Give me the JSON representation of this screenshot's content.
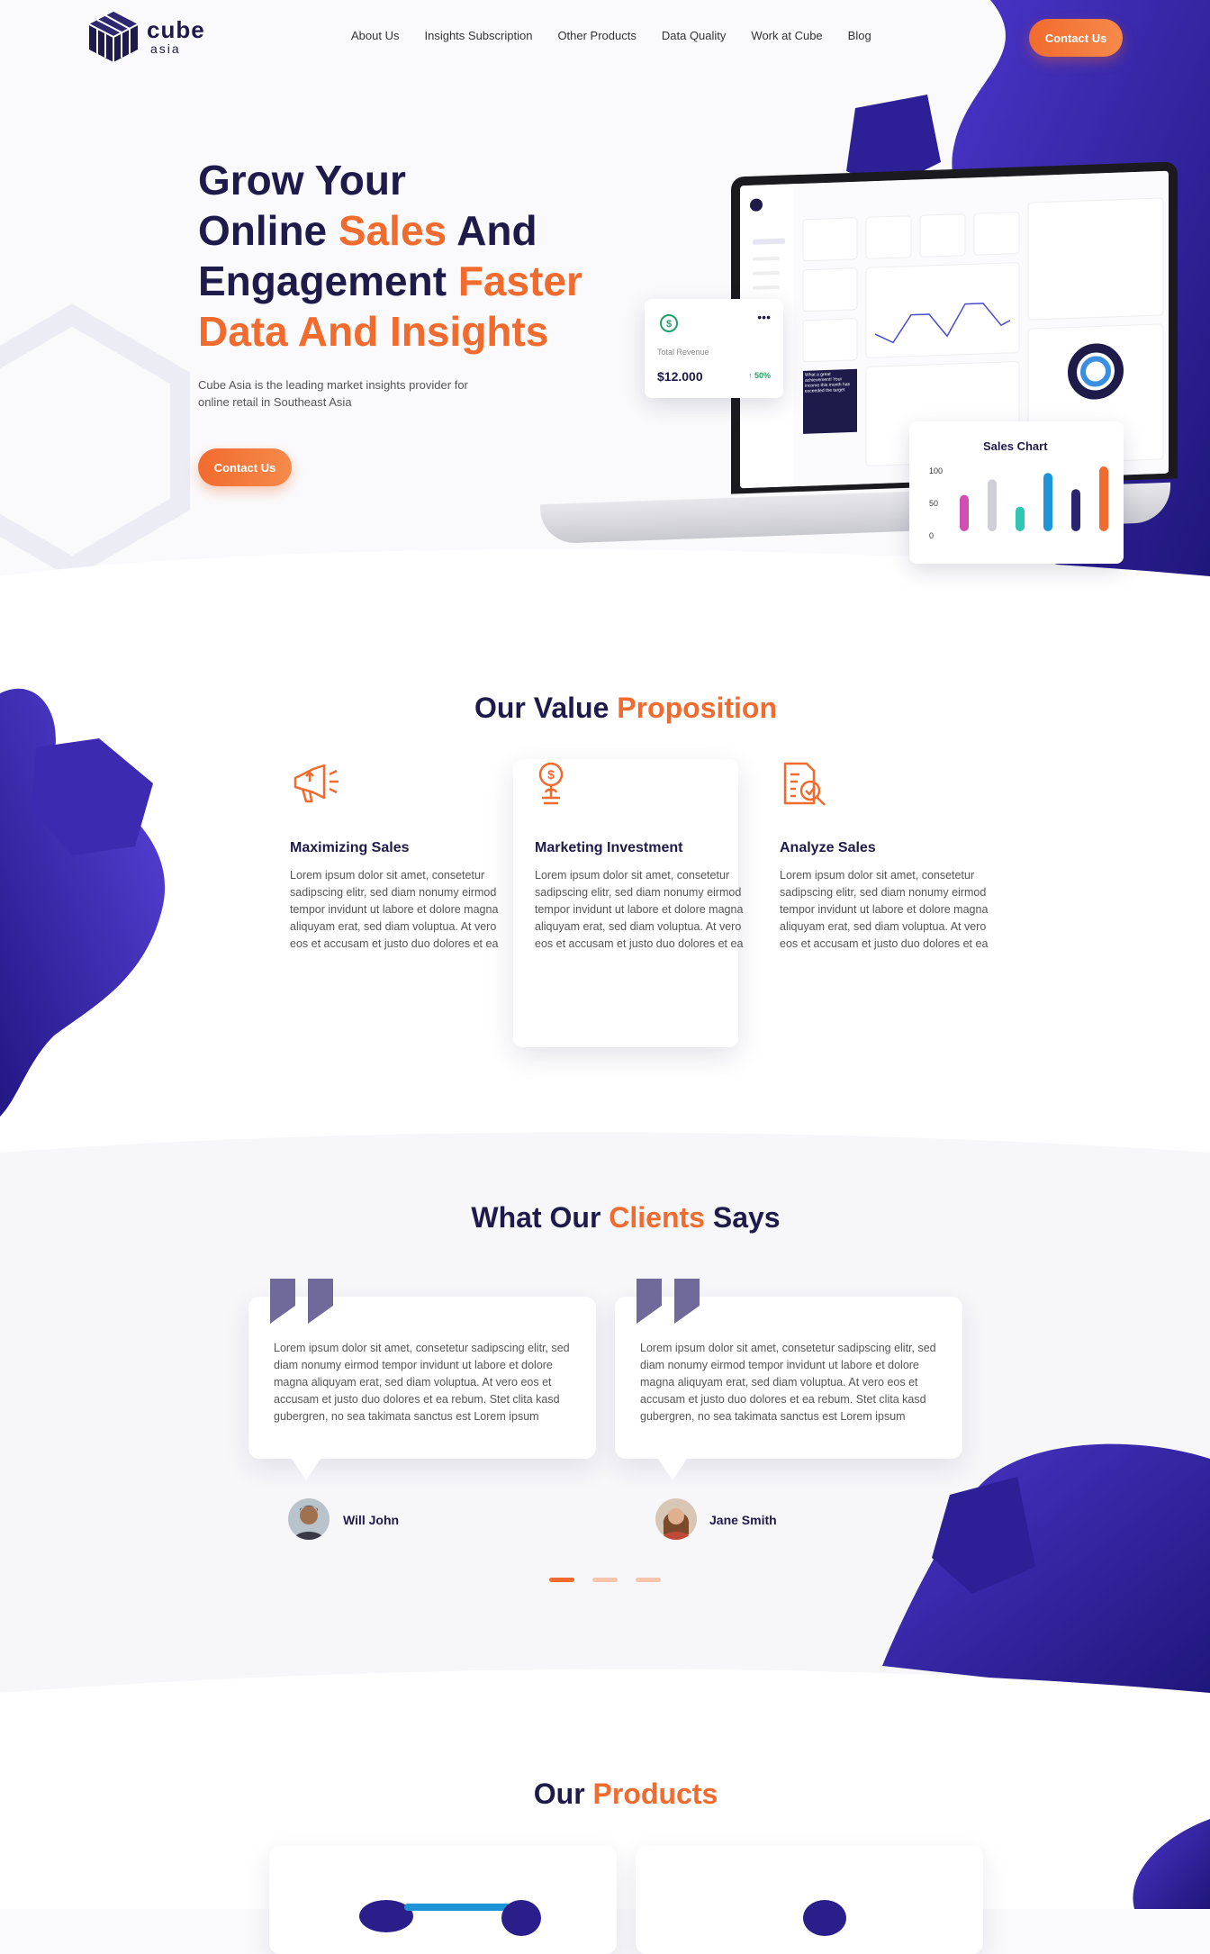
{
  "brand": {
    "name": "cube",
    "sub": "asia"
  },
  "nav": {
    "items": [
      "About Us",
      "Insights Subscription",
      "Other Products",
      "Data Quality",
      "Work at Cube",
      "Blog"
    ],
    "contact": "Contact Us"
  },
  "hero": {
    "line1": "Grow Your",
    "line2a": "Online ",
    "line2b": "Sales",
    "line2c": " And",
    "line3a": "Engagement ",
    "line3b": "Faster",
    "line4": "Data And Insights",
    "description": "Cube Asia is the leading market insights provider for online retail in Southeast Asia",
    "contact": "Contact Us",
    "revenue_card": {
      "label": "Total Revenue",
      "value": "$12.000",
      "change": "50%"
    },
    "sales_chart": {
      "title": "Sales Chart",
      "ticks": [
        "100",
        "50",
        "0"
      ],
      "values": [
        56,
        80,
        38,
        90,
        65,
        100
      ],
      "colors": [
        "#d14fb3",
        "#cfcfd6",
        "#2fc6b4",
        "#1e94d8",
        "#2a2470",
        "#f26b2e"
      ]
    },
    "dashboard_promo": "What a great achievement! Your income this month has exceeded the target"
  },
  "value": {
    "title_a": "Our Value ",
    "title_b": "Proposition",
    "features": [
      {
        "title": "Maximizing Sales",
        "icon": "megaphone-icon",
        "text": "Lorem ipsum dolor sit amet, consetetur sadipscing elitr, sed diam nonumy eirmod tempor invidunt ut labore et dolore magna aliquyam erat, sed diam voluptua. At vero eos et accusam et justo duo dolores et ea"
      },
      {
        "title": "Marketing Investment",
        "icon": "investment-icon",
        "text": "Lorem ipsum dolor sit amet, consetetur sadipscing elitr, sed diam nonumy eirmod tempor invidunt ut labore et dolore magna aliquyam erat, sed diam voluptua. At vero eos et accusam et justo duo dolores et ea"
      },
      {
        "title": "Analyze Sales",
        "icon": "analyze-icon",
        "text": "Lorem ipsum dolor sit amet, consetetur sadipscing elitr, sed diam nonumy eirmod tempor invidunt ut labore et dolore magna aliquyam erat, sed diam voluptua. At vero eos et accusam et justo duo dolores et ea"
      }
    ]
  },
  "clients": {
    "title_a": "What Our ",
    "title_b": "Clients",
    "title_c": " Says",
    "testimonials": [
      {
        "name": "Will John",
        "text": "Lorem ipsum dolor sit amet, consetetur sadipscing elitr, sed diam nonumy eirmod tempor invidunt ut labore et dolore magna aliquyam erat, sed diam voluptua. At vero eos et accusam et justo duo dolores et ea rebum. Stet clita kasd gubergren, no sea takimata sanctus est Lorem ipsum"
      },
      {
        "name": "Jane Smith",
        "text": "Lorem ipsum dolor sit amet, consetetur sadipscing elitr, sed diam nonumy eirmod tempor invidunt ut labore et dolore magna aliquyam erat, sed diam voluptua. At vero eos et accusam et justo duo dolores et ea rebum. Stet clita kasd gubergren, no sea takimata sanctus est Lorem ipsum"
      }
    ]
  },
  "products": {
    "title_a": "Our ",
    "title_b": "Products"
  },
  "colors": {
    "navy": "#1e1b4b",
    "orange": "#f26b2e",
    "purple": "#3b2aa8"
  }
}
